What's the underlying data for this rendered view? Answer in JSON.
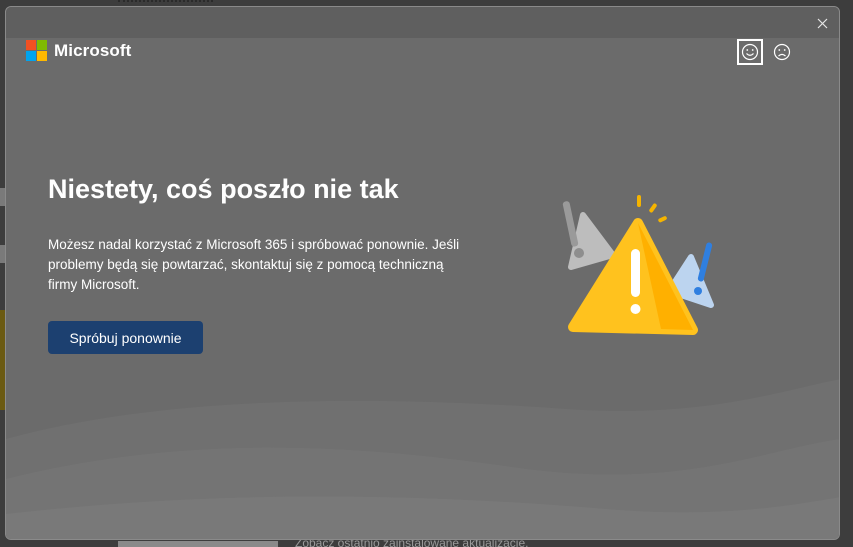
{
  "background": {
    "bottom_text": "Zobacz ostatnio zainstalowane aktualizacje."
  },
  "dialog": {
    "close_icon": "close-icon",
    "brand": {
      "name": "Microsoft",
      "logo_colors": [
        "#f25022",
        "#7fba00",
        "#00a4ef",
        "#ffb900"
      ]
    },
    "feedback": {
      "smile_icon": "smile-icon",
      "frown_icon": "frown-icon",
      "selected": "smile"
    },
    "headline": "Niestety, coś poszło nie tak",
    "message": "Możesz nadal korzystać z Microsoft 365 i spróbować ponownie. Jeśli problemy będą się powtarzać, skontaktuj się z pomocą techniczną firmy Microsoft.",
    "retry_label": "Spróbuj ponownie",
    "illustration_icon": "warning-triangles-illustration",
    "accent": "#1c4070"
  }
}
